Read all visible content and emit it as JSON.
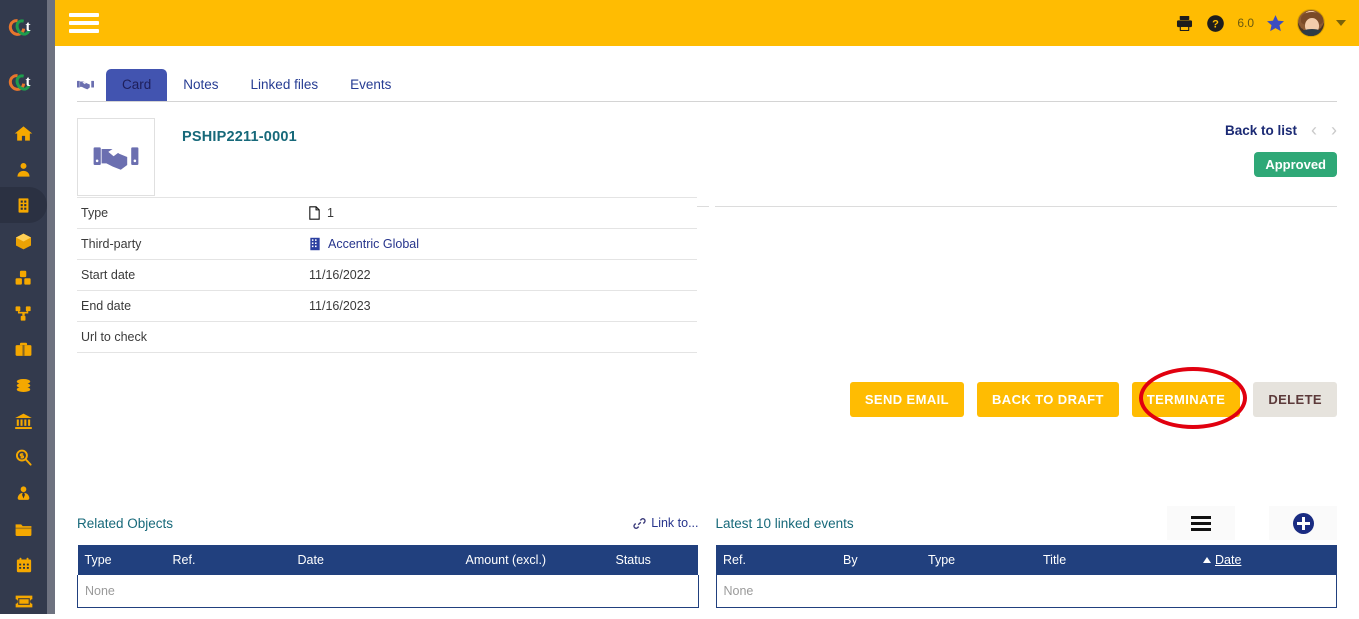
{
  "sidebar": {
    "logo_text": "t",
    "items": [
      {
        "name": "home",
        "icon": "home-icon",
        "label": "Home"
      },
      {
        "name": "members",
        "icon": "user-icon",
        "label": "Members"
      },
      {
        "name": "companies",
        "icon": "building-icon",
        "label": "Third parties",
        "active": true
      },
      {
        "name": "products",
        "icon": "box-icon",
        "label": "Products"
      },
      {
        "name": "mrp",
        "icon": "cubes-icon",
        "label": "MRP"
      },
      {
        "name": "projects",
        "icon": "share-nodes-icon",
        "label": "Projects"
      },
      {
        "name": "commercial",
        "icon": "briefcase-icon",
        "label": "Commercial"
      },
      {
        "name": "billing",
        "icon": "money-icon",
        "label": "Billing"
      },
      {
        "name": "bank",
        "icon": "bank-icon",
        "label": "Bank"
      },
      {
        "name": "accounting",
        "icon": "money-search-icon",
        "label": "Accounting"
      },
      {
        "name": "hrm",
        "icon": "user-tie-icon",
        "label": "HRM"
      },
      {
        "name": "documents",
        "icon": "folder-icon",
        "label": "Documents"
      },
      {
        "name": "agenda",
        "icon": "calendar-icon",
        "label": "Agenda"
      },
      {
        "name": "ticket",
        "icon": "ticket-icon",
        "label": "Tickets"
      }
    ]
  },
  "topbar": {
    "menu_label": "Menu",
    "print_label": "Print",
    "help_label": "Help",
    "version": "6.0",
    "bookmark_label": "Bookmarks",
    "user_label": "User menu",
    "background": "#ffbc02"
  },
  "tabs": {
    "icon": "handshake-icon",
    "items": [
      {
        "label": "Card",
        "active": true
      },
      {
        "label": "Notes",
        "active": false
      },
      {
        "label": "Linked files",
        "active": false
      },
      {
        "label": "Events",
        "active": false
      }
    ]
  },
  "card": {
    "logo_icon": "handshake-icon",
    "reference": "PSHIP2211-0001",
    "back_to_list": "Back to list",
    "prev_arrow": "‹",
    "next_arrow": "›",
    "status": "Approved",
    "status_color": "#2fa877",
    "fields": [
      {
        "label": "Type",
        "value": "1",
        "icon": "file-icon"
      },
      {
        "label": "Third-party",
        "value": "Accentric Global",
        "icon": "building-icon",
        "is_link": true
      },
      {
        "label": "Start date",
        "value": "11/16/2022",
        "icon": ""
      },
      {
        "label": "End date",
        "value": "11/16/2023",
        "icon": ""
      },
      {
        "label": "Url to check",
        "value": "",
        "icon": ""
      }
    ]
  },
  "actions": {
    "buttons": [
      {
        "label": "SEND EMAIL",
        "style": "amber"
      },
      {
        "label": "BACK TO DRAFT",
        "style": "amber"
      },
      {
        "label": "TERMINATE",
        "style": "amber",
        "highlighted": true
      },
      {
        "label": "DELETE",
        "style": "grey"
      }
    ],
    "highlight_color": "#e1000f"
  },
  "panels": {
    "related_objects": {
      "title": "Related Objects",
      "link_to_label": "Link to...",
      "link_icon": "chain-link-icon",
      "columns": [
        "Type",
        "Ref.",
        "Date",
        "Amount (excl.)",
        "Status"
      ],
      "empty_text": "None",
      "rows": []
    },
    "linked_events": {
      "title": "Latest 10 linked events",
      "menu_icon": "hamburger-icon",
      "add_icon": "plus-circle-icon",
      "columns": [
        "Ref.",
        "By",
        "Type",
        "Title",
        "Date"
      ],
      "sorted_column": "Date",
      "sort_direction": "asc",
      "empty_text": "None",
      "rows": []
    }
  }
}
